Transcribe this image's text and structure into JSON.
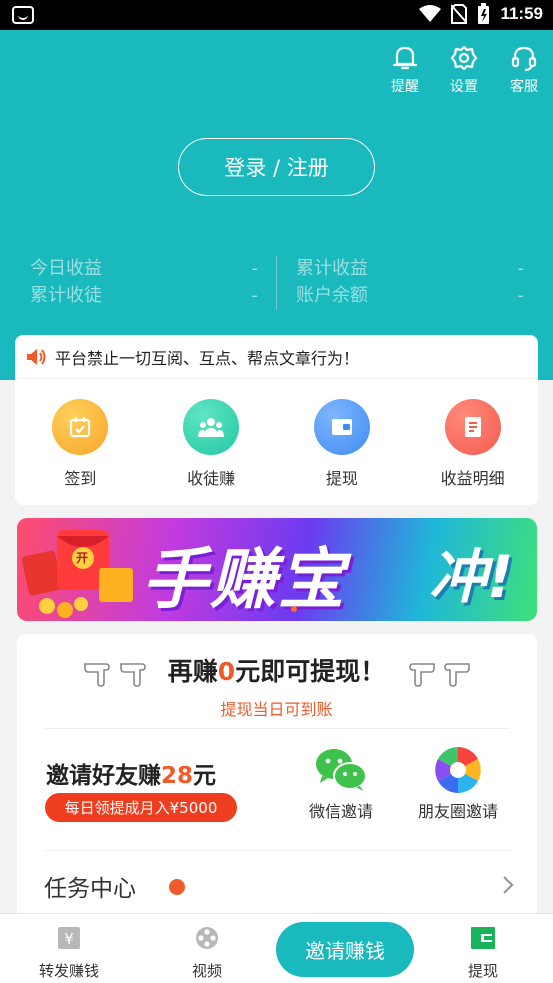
{
  "statusbar": {
    "time": "11:59"
  },
  "header": {
    "tools": [
      {
        "label": "提醒",
        "icon": "bell-icon"
      },
      {
        "label": "设置",
        "icon": "gear-icon"
      },
      {
        "label": "客服",
        "icon": "headset-icon"
      }
    ],
    "login_label": "登录 / 注册",
    "stats_left": [
      {
        "label": "今日收益",
        "value": "-"
      },
      {
        "label": "累计收徒",
        "value": "-"
      }
    ],
    "stats_right": [
      {
        "label": "累计收益",
        "value": "-"
      },
      {
        "label": "账户余额",
        "value": "-"
      }
    ]
  },
  "notice": {
    "text": "平台禁止一切互阅、互点、帮点文章行为！",
    "icon": "speaker-icon"
  },
  "quick_actions": [
    {
      "label": "签到",
      "icon": "calendar-check-icon",
      "color": "#f7a52a"
    },
    {
      "label": "收徒赚",
      "icon": "group-icon",
      "color": "#22c7a2"
    },
    {
      "label": "提现",
      "icon": "wallet-icon",
      "color": "#3f8cf2"
    },
    {
      "label": "收益明细",
      "icon": "document-icon",
      "color": "#f45b4f"
    }
  ],
  "banner": {
    "title": "手赚宝",
    "slogan": "冲!",
    "badge": "开"
  },
  "withdraw": {
    "prefix": "再赚",
    "amount": "0",
    "suffix": "元即可提现！",
    "subtitle": "提现当日可到账"
  },
  "invite": {
    "title_prefix": "邀请好友赚",
    "amount": "28",
    "title_suffix": "元",
    "pill": "每日领提成月入¥5000",
    "wechat_label": "微信邀请",
    "moments_label": "朋友圈邀请"
  },
  "task_center": {
    "label": "任务中心"
  },
  "bottom_nav": {
    "forward": "转发赚钱",
    "video": "视频",
    "invite": "邀请赚钱",
    "withdraw": "提现"
  },
  "colors": {
    "teal": "#1ab9bd",
    "orange": "#ef5b2a"
  }
}
